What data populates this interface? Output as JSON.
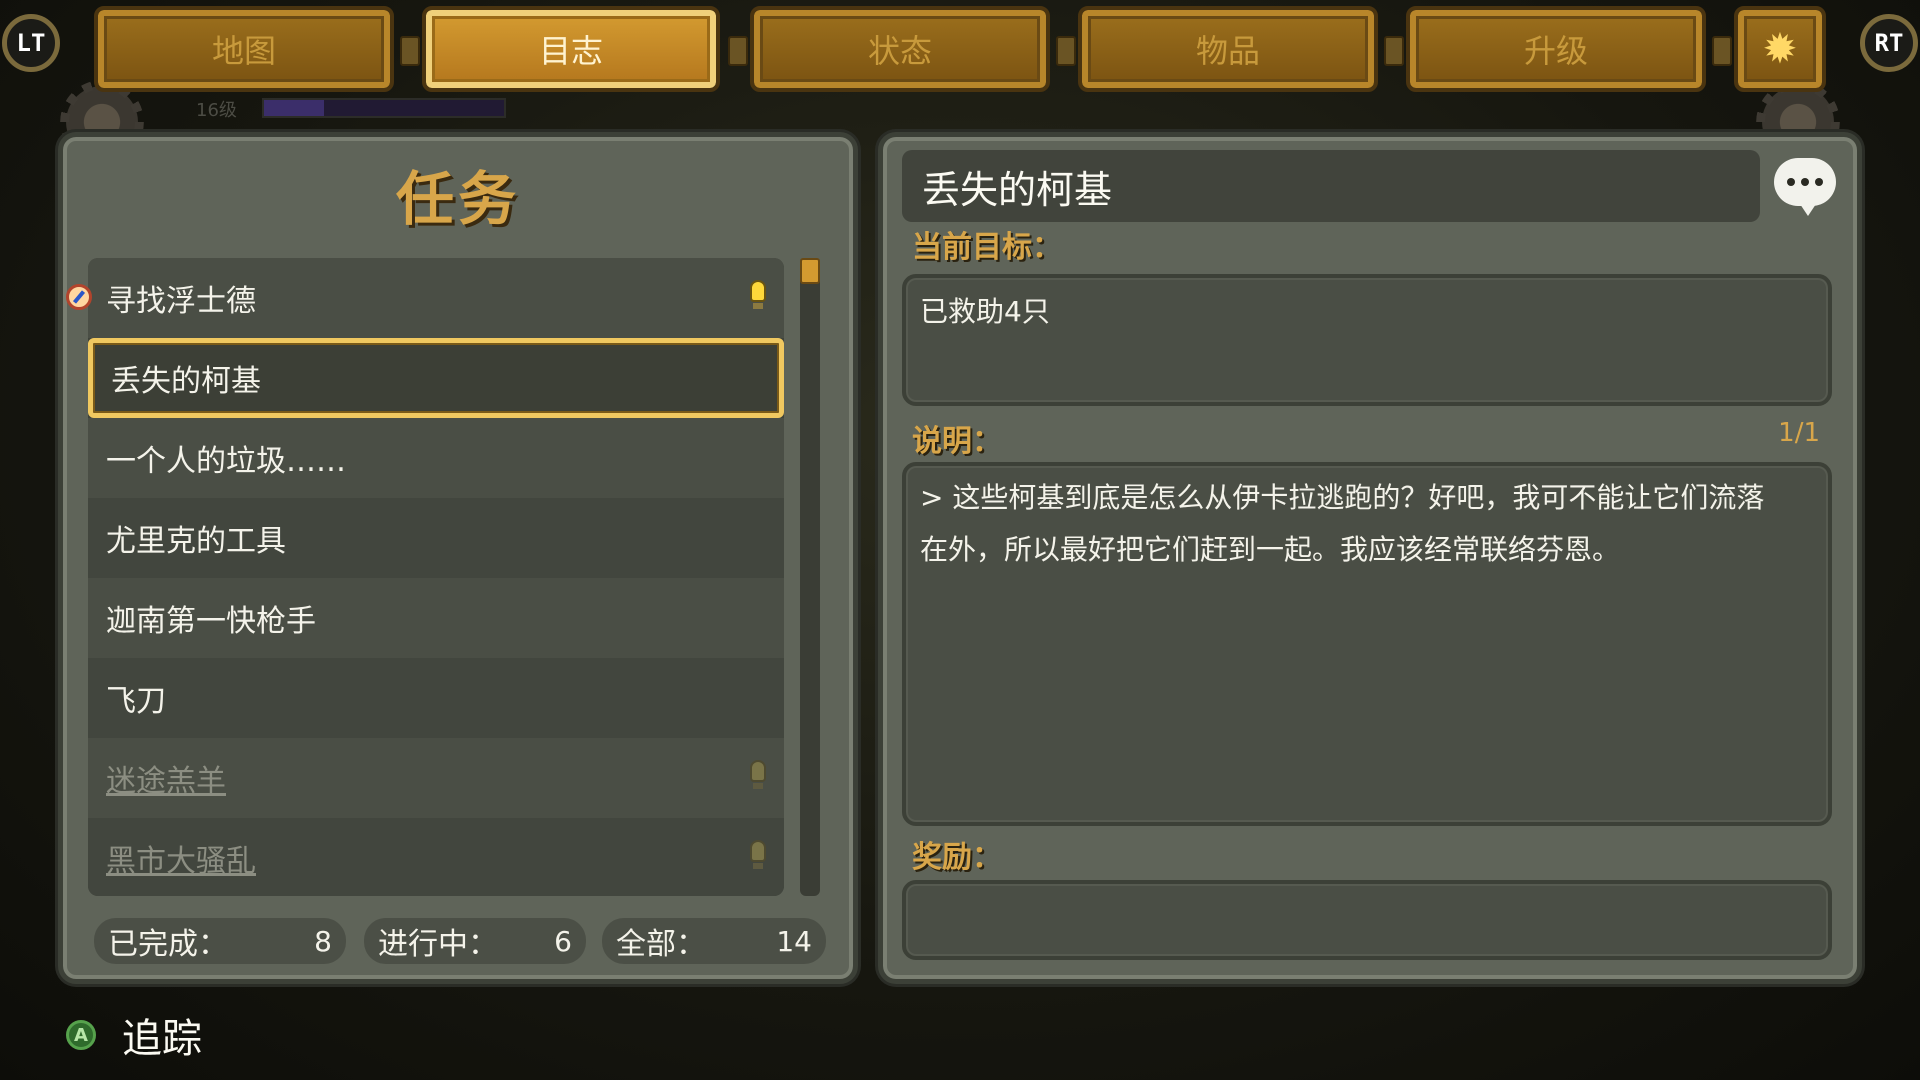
{
  "topbar": {
    "lt_label": "LT",
    "rt_label": "RT",
    "tabs": [
      "地图",
      "目志",
      "状态",
      "物品",
      "升级"
    ],
    "active_tab": "目志",
    "settings_icon": "gear-icon"
  },
  "hud": {
    "level": "16级"
  },
  "quests": {
    "title": "任务",
    "items": [
      {
        "label": "寻找浮士德",
        "tracked": true,
        "bulb": "lit"
      },
      {
        "label": "丢失的柯基",
        "selected": true
      },
      {
        "label": "一个人的垃圾……"
      },
      {
        "label": "尤里克的工具"
      },
      {
        "label": "迦南第一快枪手"
      },
      {
        "label": "飞刀"
      },
      {
        "label": "迷途羔羊",
        "completed": true,
        "bulb": "dim"
      },
      {
        "label": "黑市大骚乱",
        "completed": true,
        "bulb": "dim"
      }
    ],
    "stats": {
      "completed_label": "已完成：",
      "completed": "8",
      "in_progress_label": "进行中：",
      "in_progress": "6",
      "total_label": "全部：",
      "total": "14"
    }
  },
  "detail": {
    "title": "丢失的柯基",
    "objective_label": "当前目标：",
    "objective": "已救助4只",
    "description_label": "说明：",
    "page": "1/1",
    "description_line1": "> 这些柯基到底是怎么从伊卡拉逃跑的？好吧，我可不能让它们流落",
    "description_line2": "在外，所以最好把它们赶到一起。我应该经常联络芬恩。",
    "reward_label": "奖励："
  },
  "footer": {
    "a_button": "A",
    "track_label": "追踪"
  },
  "colors": {
    "gold": "#d8a64a",
    "tab_active": "#d39a30",
    "panel": "#5f6459",
    "bulb_lit": "#ffd83a"
  }
}
